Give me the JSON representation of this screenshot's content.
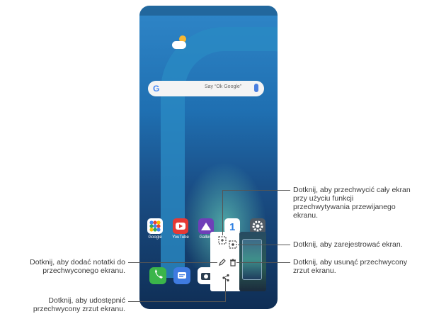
{
  "home_screen": {
    "search": {
      "hint": "Say “Ok Google”",
      "google_icon": "google-g-icon",
      "mic_icon": "microphone-icon"
    },
    "weather_icon": "partly-cloudy-weather-icon",
    "apps": [
      {
        "name": "Google",
        "icon": "google-folder-icon",
        "color": "#ffffff"
      },
      {
        "name": "YouTube",
        "icon": "youtube-icon",
        "color": "#e53935"
      },
      {
        "name": "Gallery",
        "icon": "gallery-icon",
        "color": "#6f3fb8"
      },
      {
        "name": "",
        "icon": "onestore-icon",
        "color": "#ffffff"
      },
      {
        "name": "",
        "icon": "settings-gear-icon",
        "color": "#505a64"
      }
    ],
    "dock": [
      {
        "icon": "phone-icon",
        "color": "#3bb54a"
      },
      {
        "icon": "messages-icon",
        "color": "#3f7be0"
      },
      {
        "icon": "camera-icon",
        "color": "#ffffff"
      }
    ]
  },
  "screenshot_toolbar": {
    "buttons": [
      {
        "icon": "scroll-capture-icon",
        "symbol": "⬚"
      },
      {
        "icon": "record-screen-icon",
        "symbol": "⬚"
      },
      {
        "icon": "edit-pen-icon",
        "symbol": "✎"
      },
      {
        "icon": "delete-trash-icon",
        "symbol": "Ὕ1"
      },
      {
        "icon": "share-icon",
        "symbol": "⌥"
      }
    ]
  },
  "callouts": {
    "scroll_capture": [
      "Dotknij, aby przechwycić cały ekran",
      "przy użyciu funkcji",
      "przechwytywania przewijanego",
      "ekranu."
    ],
    "record": [
      "Dotknij, aby zarejestrować ekran."
    ],
    "delete": [
      "Dotknij, aby usunąć przechwycony",
      "zrzut ekranu."
    ],
    "notes": [
      "Dotknij, aby dodać notatki do",
      "przechwyconego ekranu."
    ],
    "share": [
      "Dotknij, aby udostępnić",
      "przechwycony zrzut ekranu."
    ]
  }
}
